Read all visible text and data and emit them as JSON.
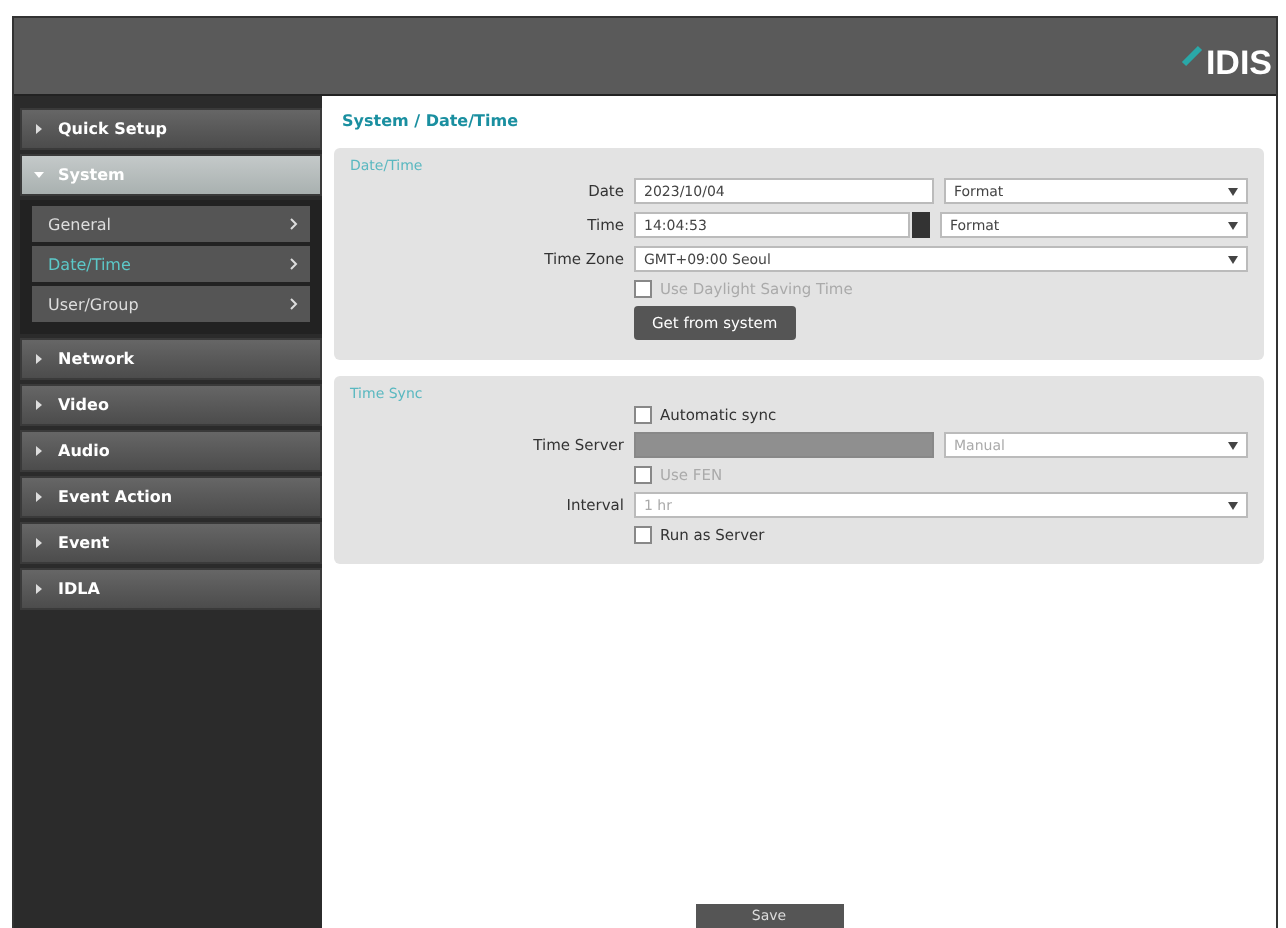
{
  "header": {
    "logo": "IDIS"
  },
  "sidebar": {
    "items": [
      {
        "label": "Quick Setup",
        "expanded": false,
        "selected": false
      },
      {
        "label": "System",
        "expanded": true,
        "selected": true,
        "children": [
          {
            "label": "General",
            "selected": false
          },
          {
            "label": "Date/Time",
            "selected": true
          },
          {
            "label": "User/Group",
            "selected": false
          }
        ]
      },
      {
        "label": "Network",
        "expanded": false,
        "selected": false
      },
      {
        "label": "Video",
        "expanded": false,
        "selected": false
      },
      {
        "label": "Audio",
        "expanded": false,
        "selected": false
      },
      {
        "label": "Event Action",
        "expanded": false,
        "selected": false
      },
      {
        "label": "Event",
        "expanded": false,
        "selected": false
      },
      {
        "label": "IDLA",
        "expanded": false,
        "selected": false
      }
    ]
  },
  "breadcrumb": "System / Date/Time",
  "date_time": {
    "title": "Date/Time",
    "date": {
      "label": "Date",
      "value": "2023/10/04",
      "format": "Format"
    },
    "time": {
      "label": "Time",
      "value": "14:04:53",
      "format": "Format"
    },
    "time_zone": {
      "label": "Time Zone",
      "value": "GMT+09:00 Seoul"
    },
    "dst": {
      "label": "Use Daylight Saving Time",
      "checked": false,
      "disabled": true
    },
    "button": "Get from system"
  },
  "time_sync": {
    "title": "Time Sync",
    "automatic": {
      "label": "Automatic sync",
      "checked": false
    },
    "server": {
      "label": "Time Server",
      "mode": "Manual",
      "disabled": true
    },
    "use_fen": {
      "label": "Use FEN",
      "checked": false,
      "disabled": true
    },
    "interval": {
      "label": "Interval",
      "value": "1 hr",
      "disabled": true
    },
    "run_as_server": {
      "label": "Run as Server",
      "checked": false
    }
  },
  "save_button": "Save"
}
